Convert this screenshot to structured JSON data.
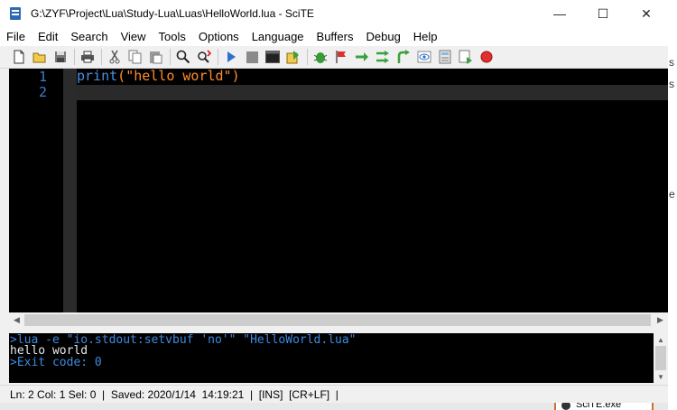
{
  "window": {
    "title": "G:\\ZYF\\Project\\Lua\\Study-Lua\\Luas\\HelloWorld.lua - SciTE",
    "minimize": "—",
    "maximize": "☐",
    "close": "✕"
  },
  "menu": [
    {
      "label": "File"
    },
    {
      "label": "Edit"
    },
    {
      "label": "Search"
    },
    {
      "label": "View"
    },
    {
      "label": "Tools"
    },
    {
      "label": "Options"
    },
    {
      "label": "Language"
    },
    {
      "label": "Buffers"
    },
    {
      "label": "Debug"
    },
    {
      "label": "Help"
    }
  ],
  "toolbar": {
    "icons": [
      "new-file-icon",
      "open-folder-icon",
      "save-icon",
      "print-icon",
      "cut-icon",
      "copy-icon",
      "paste-icon",
      "find-icon",
      "replace-icon",
      "run-icon",
      "stop-icon",
      "console-icon",
      "compile-icon",
      "debug-bug-icon",
      "flag-icon",
      "step-icon",
      "step-over-icon",
      "step-out-icon",
      "watch-eye-icon",
      "calculator-icon",
      "breakpoints-icon",
      "record-icon"
    ]
  },
  "editor": {
    "lines": [
      {
        "num": "1",
        "fn": "print",
        "open": "(",
        "str": "\"hello world\"",
        "close": ")"
      },
      {
        "num": "2"
      }
    ]
  },
  "output": {
    "lines": [
      ">lua -e \"io.stdout:setvbuf 'no'\" \"HelloWorld.lua\"",
      "hello world",
      ">Exit code: 0"
    ]
  },
  "status": {
    "text": "Ln: 2 Col: 1 Sel: 0  |  Saved: 2020/1/14  14:19:21  |  [INS]  [CR+LF]  |"
  },
  "background": {
    "taskbar_label": "SciTE.exe",
    "glyph_s1": "s",
    "glyph_s2": "s",
    "glyph_e": "e"
  },
  "colors": {
    "editor_bg": "#000000",
    "line_number": "#3c7fd0",
    "function": "#4a8fe0",
    "string": "#ff8c2a",
    "output_command": "#3c8ae0"
  }
}
